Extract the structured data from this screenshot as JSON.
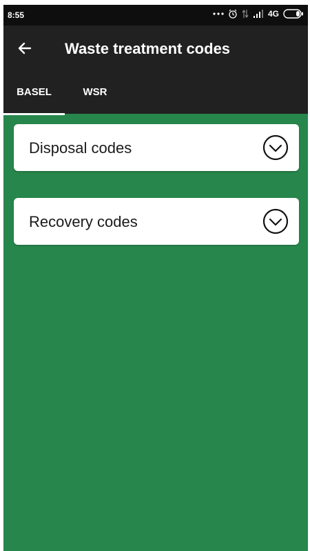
{
  "status_bar": {
    "time": "8:55",
    "network": "4G",
    "icons": [
      "more-dots-icon",
      "alarm-icon",
      "data-arrows-icon",
      "signal-icon",
      "battery-icon"
    ]
  },
  "app_bar": {
    "title": "Waste treatment codes",
    "back_icon": "arrow-left-icon"
  },
  "tabs": [
    {
      "label": "BASEL",
      "selected": true
    },
    {
      "label": "WSR",
      "selected": false
    }
  ],
  "sections": [
    {
      "label": "Disposal codes",
      "icon": "chevron-down-circle-icon",
      "expanded": false
    },
    {
      "label": "Recovery codes",
      "icon": "chevron-down-circle-icon",
      "expanded": false
    }
  ],
  "colors": {
    "background": "#27864b",
    "app_bar": "#212121",
    "status_bar": "#0e0e0e",
    "card": "#ffffff",
    "text_on_dark": "#ffffff"
  }
}
